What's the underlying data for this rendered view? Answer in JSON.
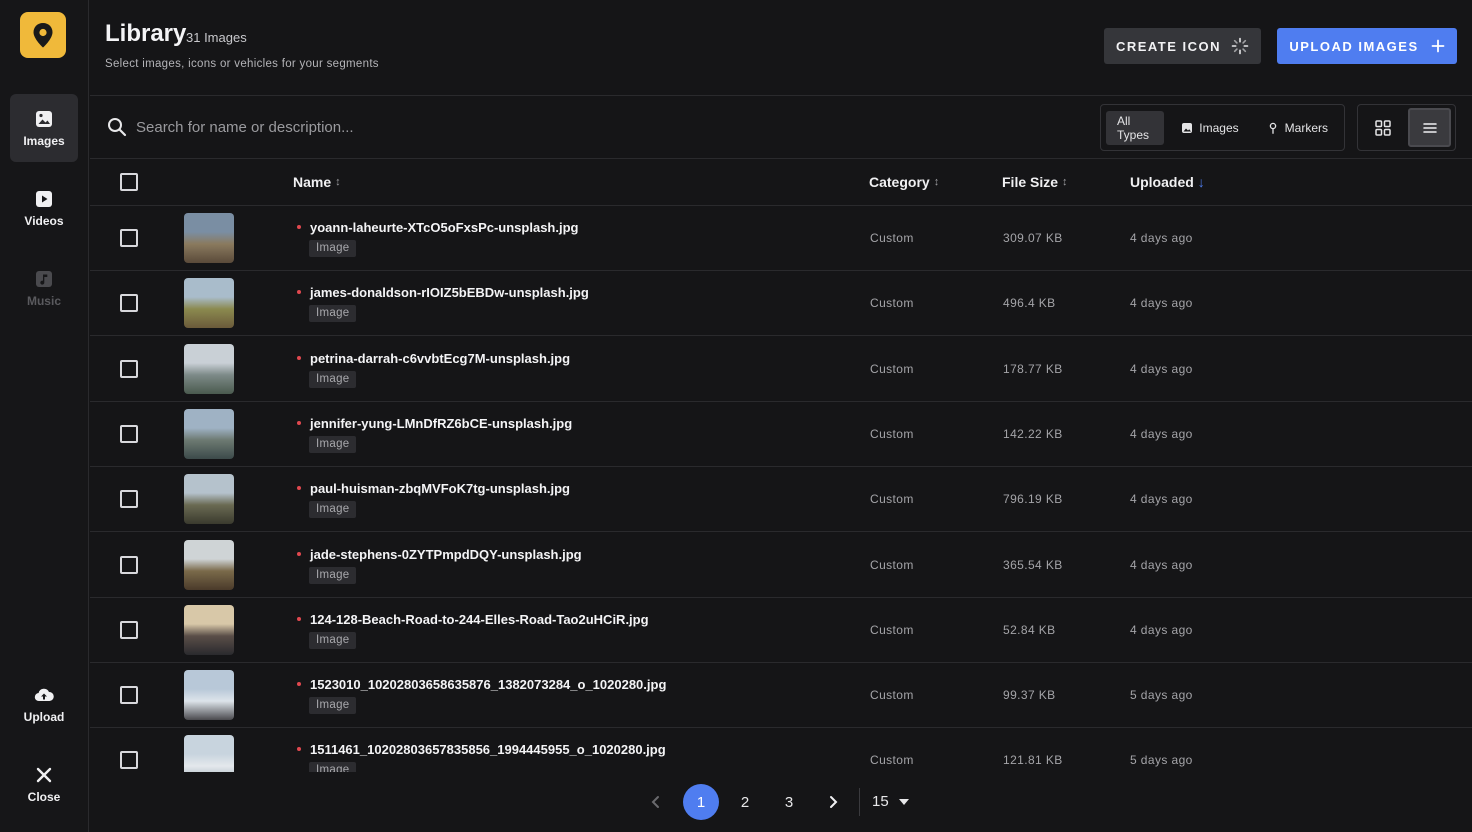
{
  "sidebar": {
    "nav": [
      {
        "label": "Images",
        "active": true,
        "disabled": false
      },
      {
        "label": "Videos",
        "active": false,
        "disabled": false
      },
      {
        "label": "Music",
        "active": false,
        "disabled": true
      }
    ],
    "upload_label": "Upload",
    "close_label": "Close"
  },
  "header": {
    "title": "Library",
    "count": "31 Images",
    "subtitle": "Select images, icons or vehicles for your segments",
    "create_icon_label": "CREATE ICON",
    "upload_images_label": "UPLOAD IMAGES"
  },
  "search": {
    "placeholder": "Search for name or description...",
    "value": ""
  },
  "type_filter": {
    "options": [
      "All Types",
      "Images",
      "Markers"
    ],
    "selected": "All Types"
  },
  "view_mode": "list",
  "table": {
    "columns": [
      "Name",
      "Category",
      "File Size",
      "Uploaded"
    ],
    "sorted_by": "Uploaded",
    "sort_direction": "desc",
    "rows": [
      {
        "name": "yoann-laheurte-XTcO5oFxsPc-unsplash.jpg",
        "type": "Image",
        "category": "Custom",
        "size": "309.07 KB",
        "uploaded": "4 days ago"
      },
      {
        "name": "james-donaldson-rIOIZ5bEBDw-unsplash.jpg",
        "type": "Image",
        "category": "Custom",
        "size": "496.4 KB",
        "uploaded": "4 days ago"
      },
      {
        "name": "petrina-darrah-c6vvbtEcg7M-unsplash.jpg",
        "type": "Image",
        "category": "Custom",
        "size": "178.77 KB",
        "uploaded": "4 days ago"
      },
      {
        "name": "jennifer-yung-LMnDfRZ6bCE-unsplash.jpg",
        "type": "Image",
        "category": "Custom",
        "size": "142.22 KB",
        "uploaded": "4 days ago"
      },
      {
        "name": "paul-huisman-zbqMVFoK7tg-unsplash.jpg",
        "type": "Image",
        "category": "Custom",
        "size": "796.19 KB",
        "uploaded": "4 days ago"
      },
      {
        "name": "jade-stephens-0ZYTPmpdDQY-unsplash.jpg",
        "type": "Image",
        "category": "Custom",
        "size": "365.54 KB",
        "uploaded": "4 days ago"
      },
      {
        "name": "124-128-Beach-Road-to-244-Elles-Road-Tao2uHCiR.jpg",
        "type": "Image",
        "category": "Custom",
        "size": "52.84 KB",
        "uploaded": "4 days ago"
      },
      {
        "name": "1523010_10202803658635876_1382073284_o_1020280.jpg",
        "type": "Image",
        "category": "Custom",
        "size": "99.37 KB",
        "uploaded": "5 days ago"
      },
      {
        "name": "1511461_10202803657835856_1994445955_o_1020280.jpg",
        "type": "Image",
        "category": "Custom",
        "size": "121.81 KB",
        "uploaded": "5 days ago"
      }
    ]
  },
  "pagination": {
    "pages": [
      "1",
      "2",
      "3"
    ],
    "current": "1",
    "per_page": "15"
  },
  "colors": {
    "accent": "#4f7df0",
    "brand": "#f0b93a",
    "dot": "#e0484f",
    "background": "#151517"
  },
  "icons": {
    "logo": "location-pin-logo",
    "images": "image-icon",
    "videos": "video-icon",
    "music": "music-icon",
    "upload": "cloud-upload-icon",
    "close": "close-icon",
    "search": "search-icon",
    "grid_view": "grid-icon",
    "list_view": "list-icon"
  }
}
